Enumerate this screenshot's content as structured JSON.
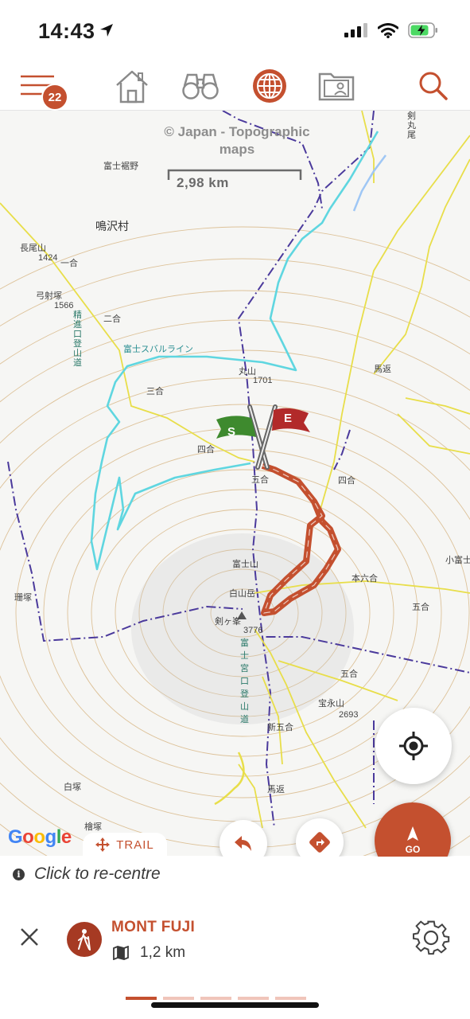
{
  "status_bar": {
    "time": "14:43"
  },
  "toolbar": {
    "menu_badge": "22",
    "items": [
      "menu-icon",
      "home-icon",
      "binoculars-icon",
      "globe-icon",
      "contacts-icon",
      "search-icon"
    ],
    "accent_color": "#c4502f",
    "icon_color": "#8a8a8a"
  },
  "map": {
    "attribution": "© Japan - Topographic maps",
    "scale_label": "2,98 km",
    "places": {
      "fujisusono": "富士裾野",
      "narusawa": "鳴沢村",
      "nagaoyama": "長尾山",
      "elev_1424": "1424",
      "ichigo": "一合",
      "yumiiyama": "弓射塚",
      "elev_1566": "1566",
      "nigo": "二合",
      "seishin_trail": "精進口登山道",
      "subaru_line": "富士スバルライン",
      "maruyama": "丸山",
      "elev_1701": "1701",
      "sango": "三合",
      "yongo_left": "四合",
      "gogo_center": "五合",
      "yongo_right": "四合",
      "umagaeshi": "馬返",
      "fujisan": "富士山",
      "hakusandake": "白山岳",
      "kengamine": "剣ヶ峯",
      "elev_3776": "3776",
      "honrokugo": "本六合",
      "kofuji": "小富士",
      "gogo_right": "五合",
      "gogo_lower": "五合",
      "hoeizan": "宝永山",
      "elev_2693": "2693",
      "shingogo": "新五合",
      "umagaeshi_lower": "馬返",
      "sangozuka": "珊塚",
      "shirozuka": "白塚",
      "hinokizuka": "檜塚",
      "fujinomiya_trail": "富士宮口登山道",
      "kenmaruo": "剣丸尾"
    },
    "start_flag": "S",
    "end_flag": "E",
    "route_color": "#c4502f"
  },
  "google_logo": "Google",
  "trail_tab": {
    "label": "TRAIL"
  },
  "buttons": {
    "go_label": "GO",
    "recenter_icon": "crosshair-icon",
    "undo_icon": "undo-arrow-icon",
    "directions_icon": "directions-icon"
  },
  "recentre_hint": "Click to re-centre",
  "trail": {
    "name": "MONT FUJI",
    "distance": "1,2 km"
  },
  "pager": {
    "pages": 5,
    "active": 1
  }
}
